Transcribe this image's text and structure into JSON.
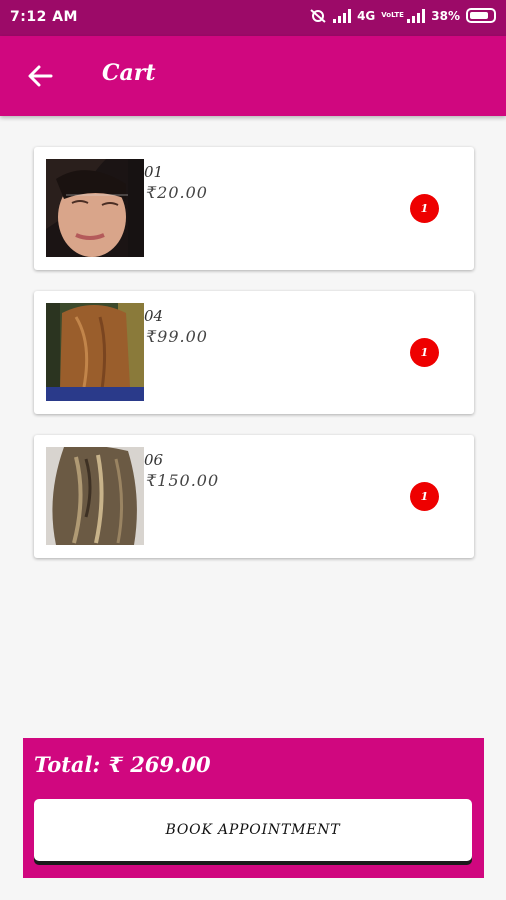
{
  "status_bar": {
    "time": "7:12 AM",
    "network_label": "4G",
    "volte_label": "VoLTE",
    "battery": "38%"
  },
  "app_bar": {
    "back_icon": "arrow-left-icon",
    "title": "Cart"
  },
  "cart": {
    "items": [
      {
        "id": "01",
        "price": "₹20.00",
        "quantity": "1",
        "image": "face-threading-photo"
      },
      {
        "id": "04",
        "price": "₹99.00",
        "quantity": "1",
        "image": "hair-back-photo"
      },
      {
        "id": "06",
        "price": "₹150.00",
        "quantity": "1",
        "image": "highlighted-hair-photo"
      }
    ]
  },
  "footer": {
    "total_label": "Total:",
    "total_value": "₹ 269.00",
    "book_button_label": "BOOK APPOINTMENT"
  },
  "colors": {
    "status_bar": "#9c0a68",
    "primary": "#d0077f",
    "badge": "#ee0000"
  }
}
